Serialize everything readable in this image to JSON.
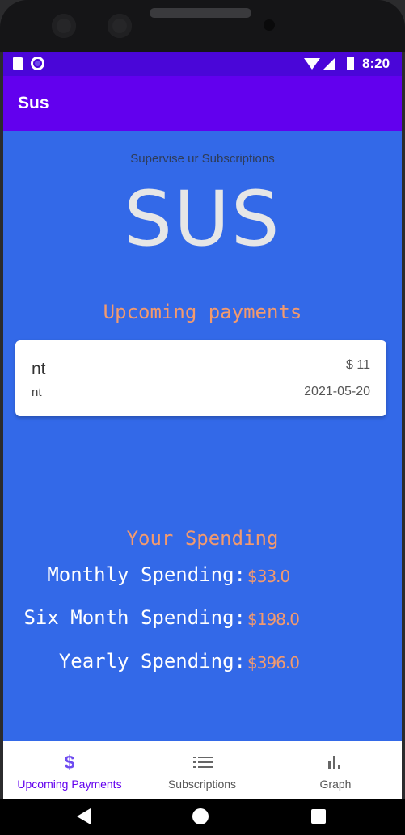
{
  "status_bar": {
    "time": "8:20"
  },
  "app_bar": {
    "title": "Sus"
  },
  "hero": {
    "tagline": "Supervise ur Subscriptions",
    "logo": "SUS"
  },
  "upcoming": {
    "heading": "Upcoming payments",
    "items": [
      {
        "name": "nt",
        "subtitle": "nt",
        "amount": "$ 11",
        "date": "2021-05-20"
      }
    ]
  },
  "spending": {
    "heading": "Your Spending",
    "rows": [
      {
        "label": "Monthly Spending:",
        "value": "$33.0"
      },
      {
        "label": "Six Month Spending:",
        "value": "$198.0"
      },
      {
        "label": "Yearly Spending:",
        "value": "$396.0"
      }
    ]
  },
  "bottom_nav": {
    "items": [
      {
        "label": "Upcoming Payments",
        "icon": "dollar-icon",
        "active": true
      },
      {
        "label": "Subscriptions",
        "icon": "list-icon",
        "active": false
      },
      {
        "label": "Graph",
        "icon": "bar-chart-icon",
        "active": false
      }
    ]
  },
  "colors": {
    "app_bar": "#6200ee",
    "status_bar": "#4a06d8",
    "background": "#3369e8",
    "accent_text": "#f39a6e",
    "active_nav": "#6200ee"
  }
}
